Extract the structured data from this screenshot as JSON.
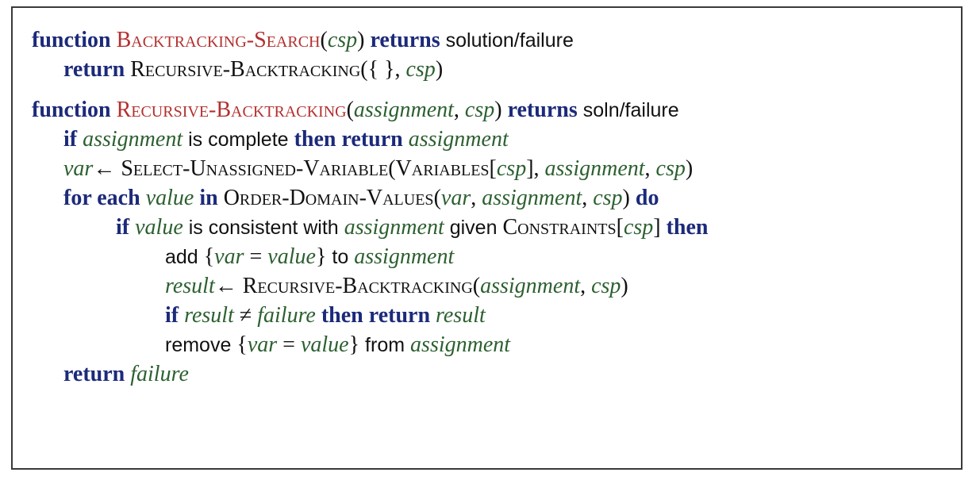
{
  "symbols": {
    "open_paren": "(",
    "close_paren": ")",
    "comma": ",",
    "open_bracket": "[",
    "close_bracket": "]",
    "open_brace": "{",
    "close_brace": "}",
    "empty_set": "{ }",
    "arrow": "←",
    "equals": "=",
    "neq": "≠"
  },
  "words": {
    "function": "function",
    "returns": "returns",
    "return": "return",
    "if": "if",
    "then": "then",
    "for_each": "for each",
    "in": "in",
    "do": "do",
    "is_complete": "is complete",
    "is_consistent_with": "is consistent with",
    "given": "given",
    "add": "add",
    "to": "to",
    "remove": "remove",
    "from": "from",
    "solution_failure": "solution/failure",
    "soln_failure": "soln/failure"
  },
  "names": {
    "backtracking_search": "Backtracking-Search",
    "recursive_backtracking": "Recursive-Backtracking",
    "select_unassigned_variable": "Select-Unassigned-Variable",
    "variables": "Variables",
    "order_domain_values": "Order-Domain-Values",
    "constraints": "Constraints"
  },
  "vars": {
    "csp": "csp",
    "assignment": "assignment",
    "var": "var",
    "value": "value",
    "result": "result",
    "failure": "failure"
  }
}
